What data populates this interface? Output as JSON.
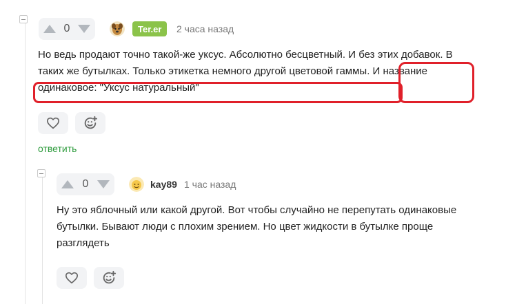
{
  "colors": {
    "accent_green": "#2f9c3e",
    "badge_green": "#8bc34a",
    "highlight_red": "#e0202a",
    "vote_bg": "#f2f3f5"
  },
  "comments": [
    {
      "votes": "0",
      "username": "Ter.er",
      "badge_style": "green-badge",
      "timestamp": "2 часа назад",
      "text_line1": "Но ведь продают точно такой-же уксус. Абсолютно бесцветный. И без этих добавок. В",
      "text_line2": "таких же бутылках. Только этикетка немного другой цветовой гаммы. И название",
      "text_line3": "одинаковое: \"Уксус натуральный\"",
      "reply_label": "ответить"
    },
    {
      "votes": "0",
      "username": "kay89",
      "timestamp": "1 час назад",
      "text_line1": "Ну это яблочный или какой другой. Вот чтобы случайно не перепутать одинаковые",
      "text_line2": "бутылки. Бывают люди с плохим зрением. Но цвет жидкости в бутылке проще",
      "text_line3": "разглядеть"
    }
  ],
  "icons": {
    "upvote": "triangle-up",
    "downvote": "triangle-down",
    "like": "heart-outline",
    "reaction": "smiley-plus",
    "collapse": "minus-box"
  }
}
